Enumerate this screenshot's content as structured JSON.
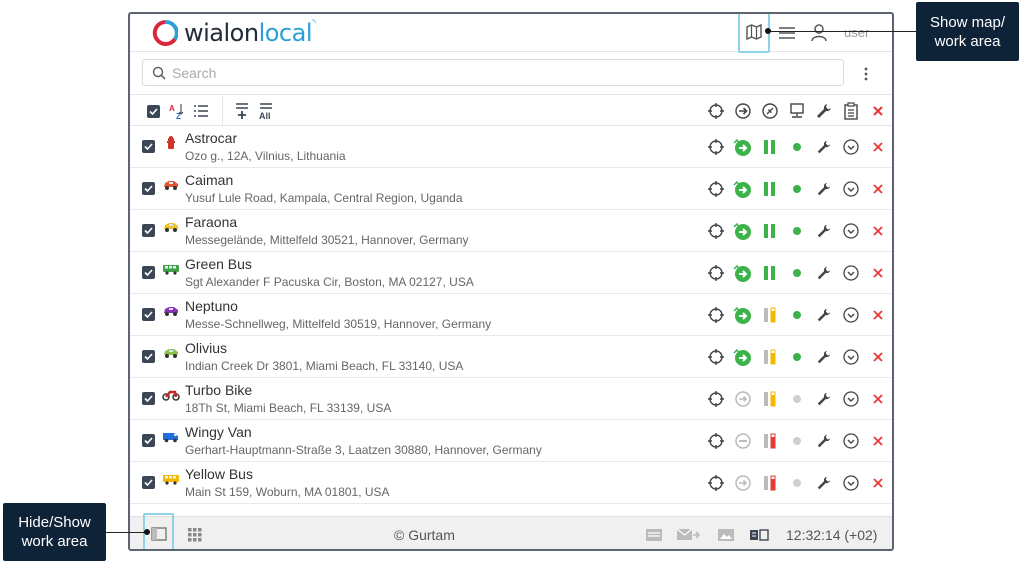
{
  "header": {
    "logo_main": "wialon",
    "logo_accent": "local",
    "user_name": "user"
  },
  "search": {
    "placeholder": "Search",
    "value": ""
  },
  "units": [
    {
      "name": "Astrocar",
      "address": "Ozo g., 12A, Vilnius, Lithuania",
      "icon": "fire-hydrant-icon",
      "icon_color": "#d2332a",
      "online": true,
      "motion": "moving",
      "ign_fill": 1.0,
      "ign_color": "#3cb34a"
    },
    {
      "name": "Caiman",
      "address": "Yusuf Lule Road, Kampala, Central Region, Uganda",
      "icon": "car-icon",
      "icon_color": "#e4572e",
      "online": true,
      "motion": "moving",
      "ign_fill": 1.0,
      "ign_color": "#3cb34a"
    },
    {
      "name": "Faraona",
      "address": "Messegelände, Mittelfeld 30521, Hannover, Germany",
      "icon": "car-icon",
      "icon_color": "#f2c12e",
      "online": true,
      "motion": "moving",
      "ign_fill": 1.0,
      "ign_color": "#3cb34a"
    },
    {
      "name": "Green Bus",
      "address": "Sgt Alexander F Pacuska Cir, Boston, MA 02127, USA",
      "icon": "bus-icon",
      "icon_color": "#43a047",
      "online": true,
      "motion": "moving",
      "ign_fill": 1.0,
      "ign_color": "#3cb34a"
    },
    {
      "name": "Neptuno",
      "address": "Messe-Schnellweg, Mittelfeld 30519, Hannover, Germany",
      "icon": "car-icon",
      "icon_color": "#8e2fb5",
      "online": true,
      "motion": "moving",
      "ign_fill": 0.75,
      "ign_color": "#f5b800"
    },
    {
      "name": "Olivius",
      "address": "Indian Creek Dr 3801, Miami Beach, FL 33140, USA",
      "icon": "car-icon",
      "icon_color": "#8bc34a",
      "online": true,
      "motion": "moving",
      "ign_fill": 0.75,
      "ign_color": "#f5b800"
    },
    {
      "name": "Turbo Bike",
      "address": "18Th St, Miami Beach, FL 33139, USA",
      "icon": "motorbike-icon",
      "icon_color": "#c62828",
      "online": false,
      "motion": "parked",
      "ign_fill": 0.75,
      "ign_color": "#f5b800"
    },
    {
      "name": "Wingy Van",
      "address": "Gerhart-Hauptmann-Straße 3, Laatzen 30880, Hannover, Germany",
      "icon": "van-icon",
      "icon_color": "#1e6fd9",
      "online": false,
      "motion": "stopped",
      "ign_fill": 0.75,
      "ign_color": "#e53935"
    },
    {
      "name": "Yellow Bus",
      "address": "Main St 159, Woburn, MA 01801, USA",
      "icon": "bus-icon",
      "icon_color": "#f5b800",
      "online": false,
      "motion": "parked",
      "ign_fill": 0.75,
      "ign_color": "#e53935"
    }
  ],
  "footer": {
    "copyright": "© Gurtam",
    "time": "12:32:14 (+02)"
  },
  "callouts": {
    "map": "Show map/ work area",
    "hide": "Hide/Show work area"
  },
  "colors": {
    "accent_green": "#3cb34a",
    "delete_red": "#e53935",
    "callout_bg": "#0f2338",
    "highlight": "#8fd3e8"
  }
}
